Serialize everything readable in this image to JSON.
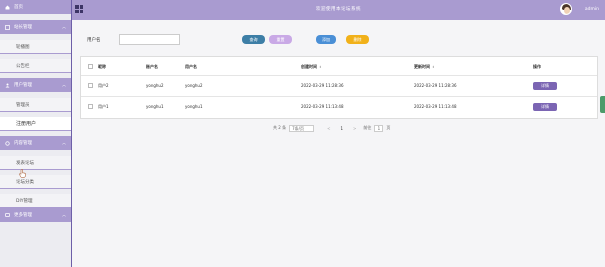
{
  "header": {
    "title": "欢迎使用本论坛系统",
    "user": "admin"
  },
  "sidebar": {
    "home": "首页",
    "sections": [
      {
        "label": "站长管理",
        "items": [
          "轮播图",
          "公告栏"
        ]
      },
      {
        "label": "用户管理",
        "items": [
          "管理员",
          "注册用户"
        ]
      },
      {
        "label": "内容管理",
        "items": [
          "发表论坛",
          "论坛分类",
          "DIY管理"
        ]
      },
      {
        "label": "更多管理",
        "items": []
      }
    ]
  },
  "search": {
    "label": "用户名",
    "placeholder": "",
    "search_label": "查询",
    "reset_label": "重置",
    "add_label": "添加",
    "delete_label": "删除"
  },
  "table": {
    "headers": [
      "昵称",
      "账户名",
      "用户名",
      "创建时间",
      "更新时间",
      "操作"
    ],
    "rows": [
      {
        "nick": "用户2",
        "acct": "yonghu2",
        "uname": "yonghu2",
        "created": "2022-03-29 11:28:36",
        "updated": "2022-03-29 11:28:36",
        "action": "详情"
      },
      {
        "nick": "用户1",
        "acct": "yonghu1",
        "uname": "yonghu1",
        "created": "2022-03-29 11:13:48",
        "updated": "2022-03-29 11:13:48",
        "action": "详情"
      }
    ]
  },
  "pager": {
    "total": "共 2 条",
    "page_size": "7条/页",
    "prev": "<",
    "current": "1",
    "next": ">",
    "goto_label": "前往",
    "goto_value": "1",
    "goto_suffix": "页"
  },
  "colors": {
    "accent": "#a99bd0",
    "detail_button": "#7b65b3",
    "search_button": "#3d7ea6",
    "delete_button": "#f1b11a"
  }
}
